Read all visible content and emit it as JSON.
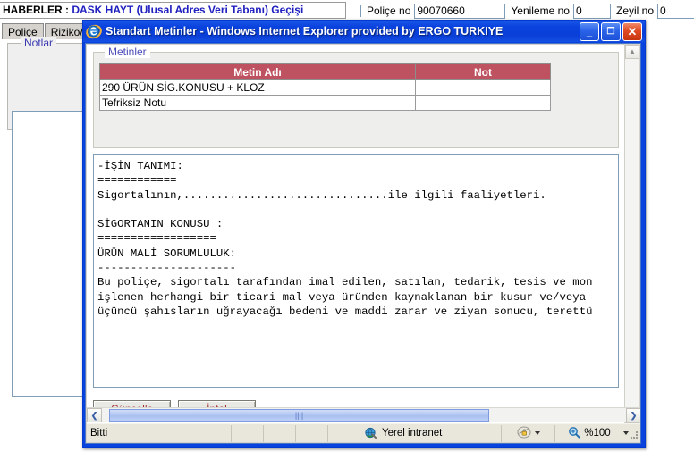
{
  "background": {
    "news": {
      "label": "HABERLER :",
      "text": "DASK HAYT (Ulusal Adres Veri Tabanı) Geçişi"
    },
    "tabs": [
      {
        "label": "Poliçe"
      },
      {
        "label": "Riziko/B"
      }
    ],
    "fieldset_legend": "Notlar",
    "fields": [
      {
        "label": "Poliçe no",
        "value": "90070660"
      },
      {
        "label": "Yenileme no",
        "value": "0"
      },
      {
        "label": "Zeyil no",
        "value": "0"
      }
    ]
  },
  "window": {
    "title": "Standart Metinler - Windows Internet Explorer provided by ERGO TURKIYE",
    "logo_icon": "internet-explorer-icon",
    "controls": {
      "minimize": "_",
      "maximize": "❐",
      "close": "✕"
    }
  },
  "content": {
    "fieldset_legend": "Metinler",
    "table": {
      "headers": [
        "Metin Adı",
        "Not"
      ],
      "rows": [
        {
          "ad": "290 ÜRÜN SİG.KONUSU + KLOZ",
          "not": ""
        },
        {
          "ad": "Tefriksiz Notu",
          "not": ""
        }
      ]
    },
    "text_body": "-İŞİN TANIMI:\n============\nSigortalının,...............................ile ilgili faaliyetleri.\n\nSİGORTANIN KONUSU :\n==================\nÜRÜN MALİ SORUMLULUK:\n---------------------\nBu poliçe, sigortalı tarafından imal edilen, satılan, tedarik, tesis ve mon\nişlenen herhangi bir ticari mal veya üründen kaynaklanan bir kusur ve/veya\nüçüncü şahısların uğrayacağı bedeni ve maddi zarar ve ziyan sonucu, terettü",
    "buttons": [
      {
        "label": "Güncelle",
        "name": "update-button"
      },
      {
        "label": "İptal",
        "name": "cancel-button"
      }
    ]
  },
  "scrollbars": {
    "vertical": {
      "up": "▲",
      "down": "▼"
    },
    "horizontal": {
      "left": "❮",
      "right": "❯",
      "thumb_grip": "||||"
    }
  },
  "statusbar": {
    "status": "Bitti",
    "zone": "Yerel intranet",
    "zone_icon": "globe-icon",
    "security_icon": "security-lock-icon",
    "zoom_icon": "magnifier-icon",
    "zoom_level": "%100"
  },
  "colors": {
    "titlebar": "#0a42de",
    "table_header": "#bf5260",
    "button_text": "#a03030",
    "legend_text": "#4a4ab8",
    "news_text": "#2020c0",
    "statusbar_bg": "#e9e7dc"
  }
}
